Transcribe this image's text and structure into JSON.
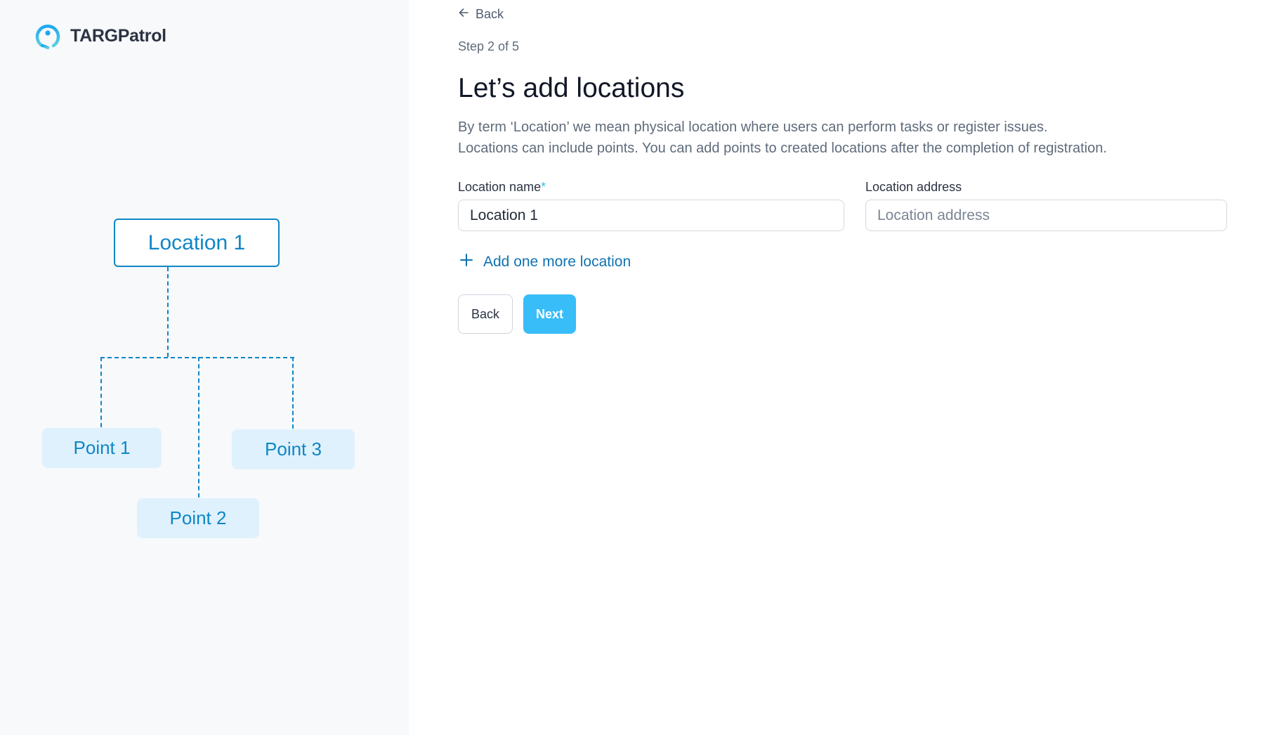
{
  "brand": {
    "name": "TARGPatrol",
    "logo_icon": "location-pin-icon",
    "accent_color": "#38bdf8"
  },
  "diagram": {
    "location": "Location 1",
    "points": [
      "Point 1",
      "Point 2",
      "Point 3"
    ],
    "line_color": "#0f86c6",
    "point_bg_color": "#dff1fd"
  },
  "nav": {
    "back_label": "Back",
    "back_icon": "arrow-left-icon"
  },
  "step": "Step 2 of 5",
  "title": "Let’s add locations",
  "description": [
    "By term ‘Location’ we mean physical location where users can perform tasks or register issues.",
    "Locations can include points. You can add points to created locations after the completion of registration."
  ],
  "form": {
    "name_label": "Location name",
    "name_required_mark": "*",
    "name_value": "Location 1",
    "address_label": "Location address",
    "address_value": "",
    "address_placeholder": "Location address"
  },
  "add_more_label": "Add one more location",
  "add_more_icon": "plus-icon",
  "buttons": {
    "back": "Back",
    "next": "Next"
  }
}
